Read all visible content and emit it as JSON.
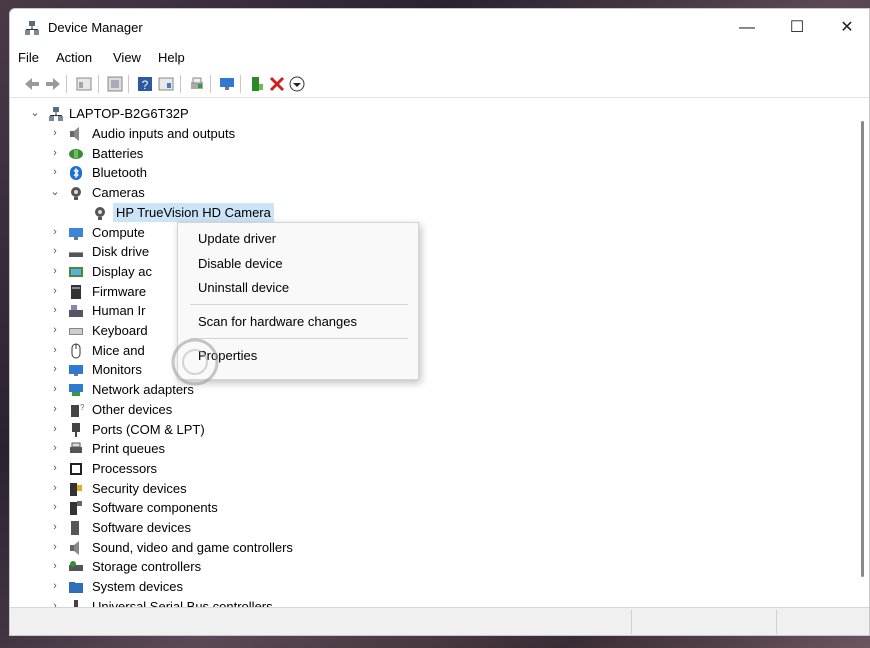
{
  "window": {
    "title": "Device Manager",
    "minimize": "—",
    "maximize": "☐",
    "close": "✕"
  },
  "menu": [
    "File",
    "Action",
    "View",
    "Help"
  ],
  "toolbar_icons": [
    "back-icon",
    "forward-icon",
    "properties-icon",
    "update-icon",
    "help-icon",
    "view-icon",
    "print-icon",
    "monitor-icon",
    "enable-device-icon",
    "uninstall-icon",
    "disable-device-icon"
  ],
  "tree": {
    "root": "LAPTOP-B2G6T32P",
    "items": [
      {
        "label": "Audio inputs and outputs",
        "icon": "speaker-icon",
        "expanded": false
      },
      {
        "label": "Batteries",
        "icon": "battery-icon",
        "expanded": false
      },
      {
        "label": "Bluetooth",
        "icon": "bluetooth-icon",
        "expanded": false
      },
      {
        "label": "Cameras",
        "icon": "camera-icon",
        "expanded": true
      },
      {
        "label": "HP TrueVision HD Camera",
        "icon": "camera-icon",
        "child": true,
        "selected": true
      },
      {
        "label": "Compute",
        "icon": "computer-icon",
        "expanded": false
      },
      {
        "label": "Disk drive",
        "icon": "disk-drive-icon",
        "expanded": false
      },
      {
        "label": "Display ac",
        "icon": "display-adapter-icon",
        "expanded": false
      },
      {
        "label": "Firmware",
        "icon": "firmware-icon",
        "expanded": false
      },
      {
        "label": "Human Ir",
        "icon": "hid-icon",
        "expanded": false
      },
      {
        "label": "Keyboard",
        "icon": "keyboard-icon",
        "expanded": false
      },
      {
        "label": "Mice and",
        "icon": "mouse-icon",
        "expanded": false
      },
      {
        "label": "Monitors",
        "icon": "monitor-icon",
        "expanded": false
      },
      {
        "label": "Network adapters",
        "icon": "network-icon",
        "expanded": false
      },
      {
        "label": "Other devices",
        "icon": "other-devices-icon",
        "expanded": false
      },
      {
        "label": "Ports (COM & LPT)",
        "icon": "port-icon",
        "expanded": false
      },
      {
        "label": "Print queues",
        "icon": "printer-icon",
        "expanded": false
      },
      {
        "label": "Processors",
        "icon": "processor-icon",
        "expanded": false
      },
      {
        "label": "Security devices",
        "icon": "security-icon",
        "expanded": false
      },
      {
        "label": "Software components",
        "icon": "software-component-icon",
        "expanded": false
      },
      {
        "label": "Software devices",
        "icon": "software-device-icon",
        "expanded": false
      },
      {
        "label": "Sound, video and game controllers",
        "icon": "speaker-icon",
        "expanded": false
      },
      {
        "label": "Storage controllers",
        "icon": "storage-icon",
        "expanded": false
      },
      {
        "label": "System devices",
        "icon": "folder-icon",
        "expanded": false
      },
      {
        "label": "Universal Serial Bus controllers",
        "icon": "usb-icon",
        "expanded": false
      }
    ]
  },
  "context_menu": {
    "update": "Update driver",
    "disable": "Disable device",
    "uninstall": "Uninstall device",
    "scan": "Scan for hardware changes",
    "properties": "Properties"
  },
  "colors": {
    "selection": "#cce4f7",
    "accent": "#0067c0"
  }
}
